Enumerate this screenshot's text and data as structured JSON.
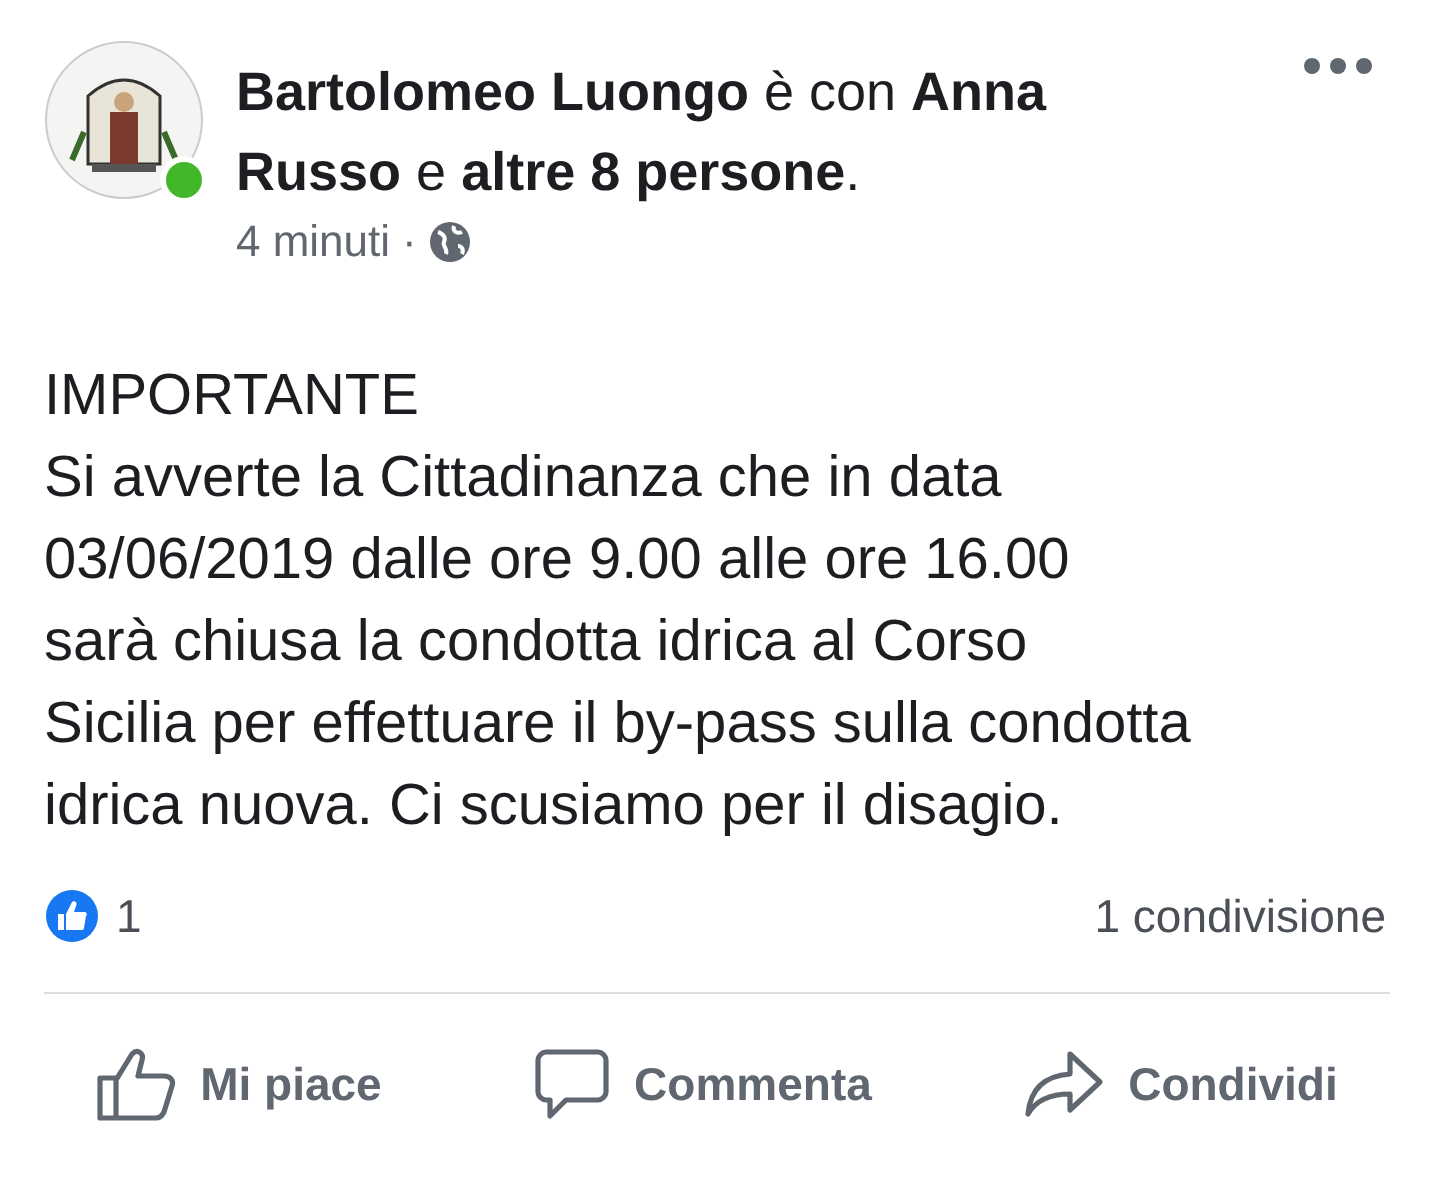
{
  "post": {
    "avatar": {
      "kind": "picture",
      "online": true
    },
    "author_line": "**Bartolomeo Luongo** è con **Anna Russo** e **altre 8 persone**.",
    "time": "4 minuti",
    "separator": "·",
    "heading": "IMPORTANTE",
    "body": "Si avverte la Cittadinanza che in data 03/06/2019 dalle ore 9.00 alle ore 16.00 sarà chiusa la condotta idrica al Corso Sicilia per effettuare il by-pass sulla condotta  idrica nuova. Ci scusiamo per il disagio.",
    "reactions_count": "1",
    "shares": "1 condivisione",
    "actions": [
      {
        "kind": "like",
        "label": "Mi piace"
      },
      {
        "kind": "comment",
        "label": "Commenta"
      },
      {
        "kind": "share",
        "label": "Condividi"
      }
    ]
  }
}
